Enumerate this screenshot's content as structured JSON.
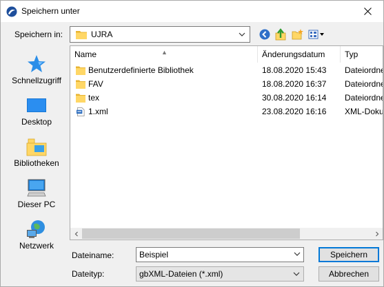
{
  "window": {
    "title": "Speichern unter"
  },
  "location": {
    "label": "Speichern in:",
    "value": "UJRA"
  },
  "toolbar": {
    "icons": [
      "back-icon",
      "up-folder-icon",
      "new-folder-icon",
      "view-menu-icon"
    ]
  },
  "places": [
    {
      "label": "Schnellzugriff",
      "icon": "star-icon"
    },
    {
      "label": "Desktop",
      "icon": "desktop-icon"
    },
    {
      "label": "Bibliotheken",
      "icon": "libraries-icon"
    },
    {
      "label": "Dieser PC",
      "icon": "computer-icon"
    },
    {
      "label": "Netzwerk",
      "icon": "network-icon"
    }
  ],
  "columns": {
    "name": "Name",
    "date": "Änderungsdatum",
    "type": "Typ"
  },
  "files": [
    {
      "name": "Benutzerdefinierte Bibliothek",
      "date": "18.08.2020 15:43",
      "type": "Dateiordner",
      "icon": "folder-icon"
    },
    {
      "name": "FAV",
      "date": "18.08.2020 16:37",
      "type": "Dateiordner",
      "icon": "folder-icon"
    },
    {
      "name": "tex",
      "date": "30.08.2020 16:14",
      "type": "Dateiordner",
      "icon": "folder-icon"
    },
    {
      "name": "1.xml",
      "date": "23.08.2020 16:16",
      "type": "XML-Dokument",
      "icon": "xml-file-icon"
    }
  ],
  "filename": {
    "label": "Dateiname:",
    "value": "Beispiel"
  },
  "filetype": {
    "label": "Dateityp:",
    "value": "gbXML-Dateien (*.xml)"
  },
  "buttons": {
    "save": "Speichern",
    "cancel": "Abbrechen"
  },
  "colors": {
    "folder": "#ffd766",
    "accent": "#0078d7"
  }
}
